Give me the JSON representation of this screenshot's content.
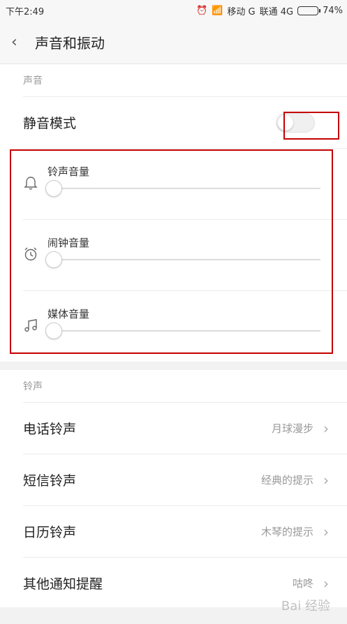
{
  "status": {
    "time": "下午2:49",
    "carrier1": "移动 G",
    "carrier2": "联通 4G",
    "battery": "74%",
    "battery_level": 0.74
  },
  "header": {
    "title": "声音和振动"
  },
  "sound_section": {
    "label": "声音",
    "mute_label": "静音模式",
    "mute_on": false,
    "sliders": [
      {
        "label": "铃声音量",
        "icon": "bell-icon",
        "value": 0
      },
      {
        "label": "闹钟音量",
        "icon": "alarm-icon",
        "value": 0
      },
      {
        "label": "媒体音量",
        "icon": "music-icon",
        "value": 0
      }
    ]
  },
  "ringtone_section": {
    "label": "铃声",
    "items": [
      {
        "label": "电话铃声",
        "value": "月球漫步"
      },
      {
        "label": "短信铃声",
        "value": "经典的提示"
      },
      {
        "label": "日历铃声",
        "value": "木琴的提示"
      },
      {
        "label": "其他通知提醒",
        "value": "咕咚"
      }
    ]
  },
  "watermark": "Bai 经验",
  "colors": {
    "highlight": "#c40000"
  }
}
